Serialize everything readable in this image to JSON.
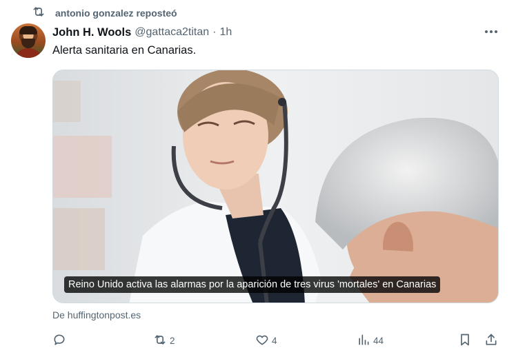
{
  "repost": {
    "icon": "repost-icon",
    "text": "antonio gonzalez reposteó"
  },
  "post": {
    "author_name": "John H. Wools",
    "author_handle": "@gattaca2titan",
    "separator": "·",
    "time": "1h",
    "text": "Alerta sanitaria en Canarias.",
    "more_icon": "more-horizontal-icon"
  },
  "card": {
    "caption": "Reino Unido activa las alarmas por la aparición de tres virus 'mortales' en Canarias",
    "source": "De huffingtonpost.es"
  },
  "actions": {
    "reply": {
      "icon": "reply-icon",
      "count": ""
    },
    "repost": {
      "icon": "repost-icon",
      "count": "2"
    },
    "like": {
      "icon": "heart-icon",
      "count": "4"
    },
    "views": {
      "icon": "views-chart-icon",
      "count": "44"
    },
    "bookmark": {
      "icon": "bookmark-icon",
      "count": ""
    },
    "share": {
      "icon": "share-icon",
      "count": ""
    }
  },
  "colors": {
    "text_primary": "#0f1419",
    "text_secondary": "#536471",
    "border": "#cfd9de"
  }
}
